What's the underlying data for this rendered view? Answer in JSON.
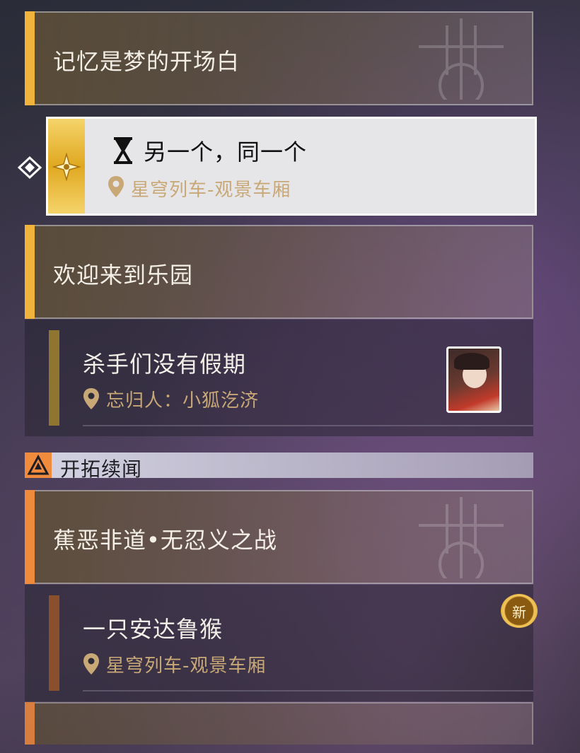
{
  "chapters": [
    {
      "title": "记忆是梦的开场白"
    },
    {
      "title": "欢迎来到乐园"
    },
    {
      "title": "蕉恶非道•无忍义之战"
    }
  ],
  "selected_quest": {
    "title": "另一个，同一个",
    "location": "星穹列车-观景车厢"
  },
  "quests": [
    {
      "title": "杀手们没有假期",
      "location": "忘归人：小狐汔济"
    },
    {
      "title": "一只安达鲁猴",
      "location": "星穹列车-观景车厢",
      "badge": "新"
    }
  ],
  "section": {
    "label": "开拓续闻"
  },
  "icons": {
    "pointer": "diamond-pointer-icon",
    "hourglass": "hourglass-icon",
    "location": "location-pin-icon",
    "section": "trailblaze-icon"
  },
  "colors": {
    "gold": "#f0b43c",
    "orange": "#f08a3c",
    "location_text": "#c9a877"
  }
}
